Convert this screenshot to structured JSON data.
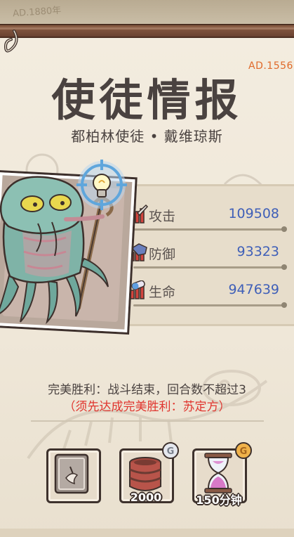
{
  "header": {
    "era_tag": "AD.1556",
    "background_date": "AD.1880年",
    "title": "使徒情报",
    "subtitle": "都柏林使徒 • 戴维琼斯"
  },
  "stats": [
    {
      "label": "攻击",
      "value": "109508",
      "icon": "sword-icon"
    },
    {
      "label": "防御",
      "value": "93323",
      "icon": "shield-icon"
    },
    {
      "label": "生命",
      "value": "947639",
      "icon": "heart-icon"
    }
  ],
  "victory": {
    "condition": "完美胜利：战斗结束，回合数不超过3",
    "requirement": "（须先达成完美胜利：苏定方）"
  },
  "rewards": [
    {
      "name": "card-reward",
      "amount": "",
      "icon": "card-icon"
    },
    {
      "name": "barrel-reward",
      "amount": "2000",
      "icon": "barrel-icon"
    },
    {
      "name": "time-reward",
      "amount": "150分钟",
      "icon": "hourglass-icon"
    }
  ],
  "colors": {
    "title": "#4a4240",
    "era_tag": "#e06a2a",
    "stat_value": "#3f5fb8",
    "requirement": "#e0352e",
    "paper": "#f3ecdf"
  }
}
